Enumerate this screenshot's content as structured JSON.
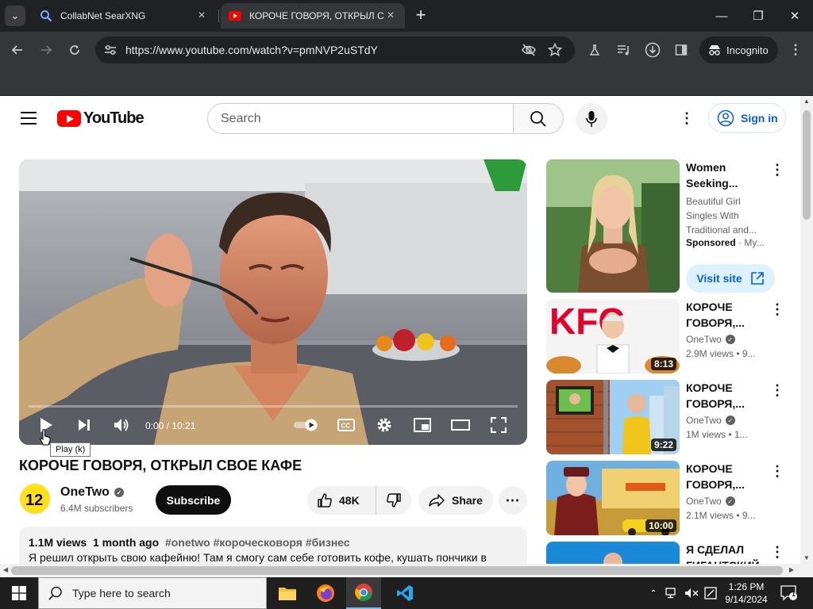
{
  "browser": {
    "tabs": [
      {
        "title": "CollabNet SearXNG"
      },
      {
        "title": "КОРОЧЕ ГОВОРЯ, ОТКРЫЛ СВОЕ КАФЕ"
      }
    ],
    "url": "https://www.youtube.com/watch?v=pmNVP2uSTdY",
    "profile_label": "Incognito"
  },
  "youtube": {
    "logo_text": "YouTube",
    "search_placeholder": "Search",
    "signin_label": "Sign in"
  },
  "player": {
    "time": "0:00 / 10:21",
    "tooltip": "Play (k)",
    "progress": 0
  },
  "video": {
    "title": "КОРОЧЕ ГОВОРЯ, ОТКРЫЛ СВОЕ КАФЕ",
    "channel": "OneTwo",
    "subscribers": "6.4M subscribers",
    "subscribe_label": "Subscribe",
    "likes": "48K",
    "share_label": "Share",
    "views": "1.1M views",
    "age": "1 month ago",
    "tags": "#onetwo #короческоворя #бизнес",
    "description": "Я решил открыть свою кафейню! Там я смогу сам себе готовить кофе, кушать пончики в"
  },
  "sidebar": {
    "ad": {
      "title": "Women Seeking...",
      "description": "Beautiful Girl Singles With Traditional and...",
      "sponsored": "Sponsored",
      "advertiser": "My...",
      "cta": "Visit site"
    },
    "videos": [
      {
        "title": "КОРОЧЕ ГОВОРЯ,...",
        "channel": "OneTwo",
        "views": "2.9M views • 9...",
        "duration": "8:13"
      },
      {
        "title": "КОРОЧЕ ГОВОРЯ,...",
        "channel": "OneTwo",
        "views": "1M views • 1...",
        "duration": "9:22"
      },
      {
        "title": "КОРОЧЕ ГОВОРЯ,...",
        "channel": "OneTwo",
        "views": "2.1M views • 9...",
        "duration": "10:00"
      },
      {
        "title": "Я СДЕЛАЛ ГИГАНТСКИЙ...",
        "channel": "",
        "views": "",
        "duration": ""
      }
    ]
  },
  "taskbar": {
    "search_placeholder": "Type here to search",
    "time": "1:26 PM",
    "date": "9/14/2024",
    "notification_count": "1"
  }
}
